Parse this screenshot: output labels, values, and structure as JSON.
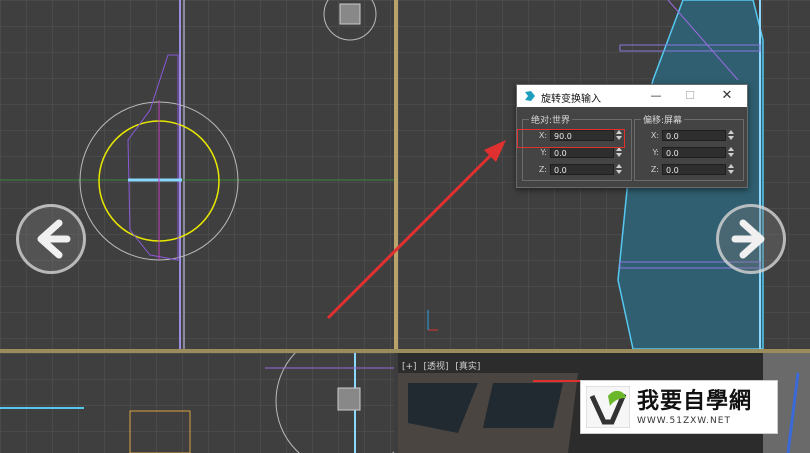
{
  "dialog": {
    "title": "旋转变换输入",
    "minimize": "—",
    "maximize": "☐",
    "close": "✕",
    "absolute_group_label": "绝对:世界",
    "offset_group_label": "偏移:屏幕",
    "absolute": [
      {
        "axis": "X:",
        "value": "90.0"
      },
      {
        "axis": "Y:",
        "value": "0.0"
      },
      {
        "axis": "Z:",
        "value": "0.0"
      }
    ],
    "offset": [
      {
        "axis": "X:",
        "value": "0.0"
      },
      {
        "axis": "Y:",
        "value": "0.0"
      },
      {
        "axis": "Z:",
        "value": "0.0"
      }
    ]
  },
  "perspective": {
    "plus": "[+]",
    "view": "[透视]",
    "shading": "[真实]"
  },
  "watermark": {
    "text": "我要自學網",
    "url": "WWW.51ZXW.NET"
  },
  "colors": {
    "highlight": "#e03030",
    "arrow": "#e03030",
    "gizmo_yellow": "#e8e800",
    "dialog_bg": "#444444"
  }
}
